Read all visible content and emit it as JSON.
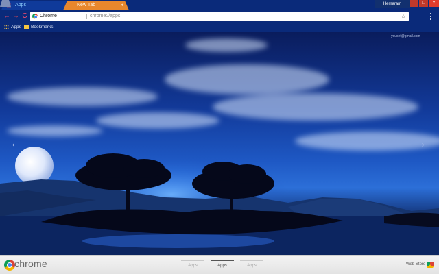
{
  "tabs": [
    {
      "label": "Apps",
      "close": "×"
    },
    {
      "label": "New Tab",
      "close": "×"
    }
  ],
  "window": {
    "user": "Hemaram",
    "minimize": "–",
    "maximize": "□",
    "close": "×"
  },
  "toolbar": {
    "back": "←",
    "forward": "→",
    "reload": "C",
    "omnibox_label": "Chrome",
    "url": "chrome://apps",
    "star": "☆"
  },
  "bookmarks": [
    {
      "label": "Apps",
      "icon": "apps-grid-icon"
    },
    {
      "label": "Bookmarks",
      "icon": "folder-icon"
    }
  ],
  "wallpaper": {
    "email": "yousef@gmail.com",
    "prev": "‹",
    "next": "›"
  },
  "bottombar": {
    "logo_text": "chrome",
    "pages": [
      "Apps",
      "Apps",
      "Apps"
    ],
    "active_page": 2,
    "webstore_label": "Web Store"
  },
  "colors": {
    "tabstrip": "#0a2a7a",
    "active_tab": "#0f3a9a",
    "new_tab": "#e8872d",
    "window_close": "#e03b2b"
  }
}
